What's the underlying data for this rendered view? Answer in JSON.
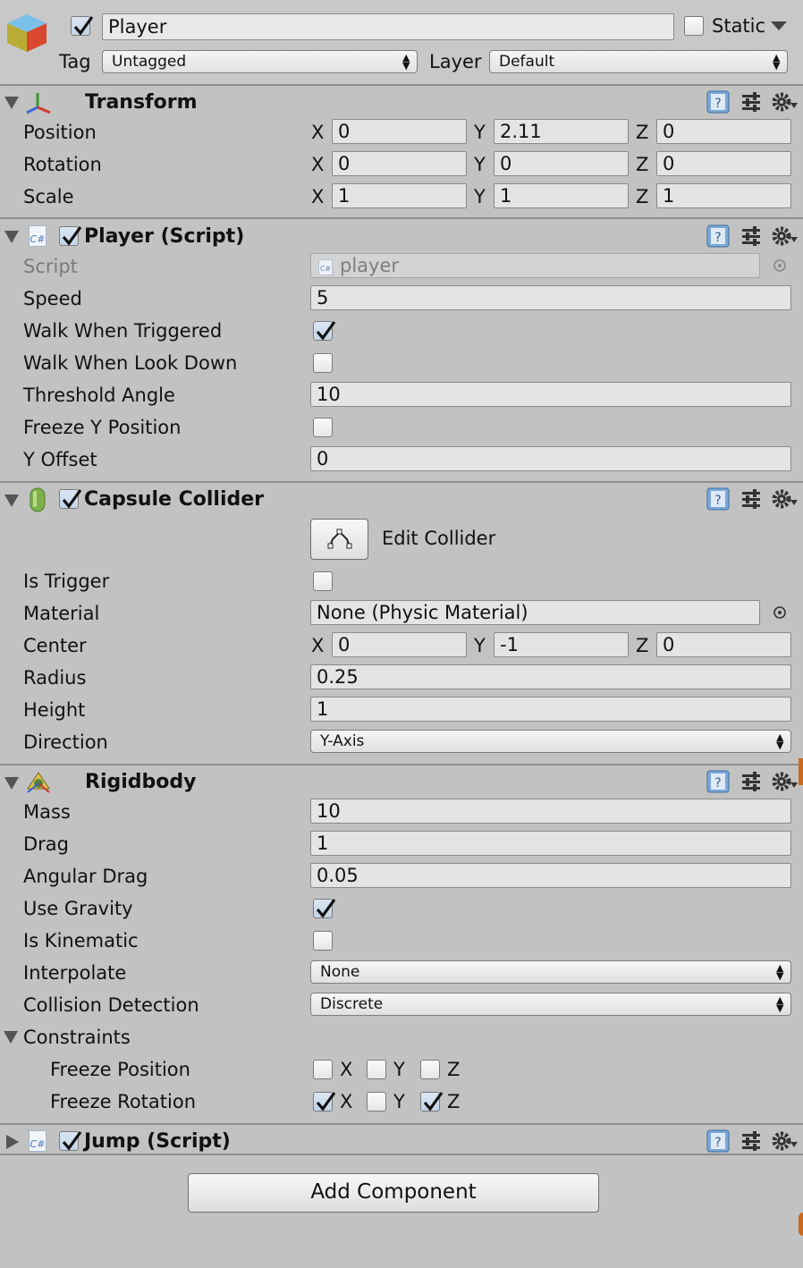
{
  "header": {
    "object_name": "Player",
    "active_checked": true,
    "static_label": "Static",
    "static_checked": false,
    "tag_label": "Tag",
    "tag_value": "Untagged",
    "layer_label": "Layer",
    "layer_value": "Default"
  },
  "transform": {
    "title": "Transform",
    "rows": [
      {
        "label": "Position",
        "x": "0",
        "y": "2.11",
        "z": "0"
      },
      {
        "label": "Rotation",
        "x": "0",
        "y": "0",
        "z": "0"
      },
      {
        "label": "Scale",
        "x": "1",
        "y": "1",
        "z": "1"
      }
    ],
    "axis": {
      "x": "X",
      "y": "Y",
      "z": "Z"
    }
  },
  "player_script": {
    "title": "Player (Script)",
    "enabled": true,
    "cs_icon": "C#",
    "script_label": "Script",
    "script_value": "player",
    "speed_label": "Speed",
    "speed_value": "5",
    "walk_triggered_label": "Walk When Triggered",
    "walk_triggered": true,
    "walk_look_down_label": "Walk When Look Down",
    "walk_look_down": false,
    "threshold_label": "Threshold Angle",
    "threshold_value": "10",
    "freeze_y_label": "Freeze Y Position",
    "freeze_y": false,
    "y_offset_label": "Y Offset",
    "y_offset_value": "0"
  },
  "capsule_collider": {
    "title": "Capsule Collider",
    "enabled": true,
    "edit_collider_label": "Edit Collider",
    "is_trigger_label": "Is Trigger",
    "is_trigger": false,
    "material_label": "Material",
    "material_value": "None (Physic Material)",
    "center_label": "Center",
    "center": {
      "x": "0",
      "y": "-1",
      "z": "0"
    },
    "radius_label": "Radius",
    "radius_value": "0.25",
    "height_label": "Height",
    "height_value": "1",
    "direction_label": "Direction",
    "direction_value": "Y-Axis"
  },
  "rigidbody": {
    "title": "Rigidbody",
    "mass_label": "Mass",
    "mass_value": "10",
    "drag_label": "Drag",
    "drag_value": "1",
    "angular_drag_label": "Angular Drag",
    "angular_drag_value": "0.05",
    "use_gravity_label": "Use Gravity",
    "use_gravity": true,
    "is_kinematic_label": "Is Kinematic",
    "is_kinematic": false,
    "interpolate_label": "Interpolate",
    "interpolate_value": "None",
    "collision_label": "Collision Detection",
    "collision_value": "Discrete",
    "constraints_label": "Constraints",
    "freeze_position_label": "Freeze Position",
    "freeze_position": {
      "x": false,
      "y": false,
      "z": false
    },
    "freeze_rotation_label": "Freeze Rotation",
    "freeze_rotation": {
      "x": true,
      "y": false,
      "z": true
    }
  },
  "jump_script": {
    "title": "Jump (Script)",
    "enabled": true,
    "cs_icon": "C#"
  },
  "add_component_label": "Add Component",
  "colors": {
    "background": "#c2c2c2",
    "field": "#e4e4e4",
    "accent_orange": "#c86a1e"
  },
  "icons": [
    "game-object-cube-icon",
    "transform-axes-icon",
    "csharp-script-icon",
    "capsule-icon",
    "rigidbody-icon",
    "help-book-icon",
    "preset-sliders-icon",
    "gear-icon",
    "object-picker-icon",
    "edit-collider-icon"
  ]
}
